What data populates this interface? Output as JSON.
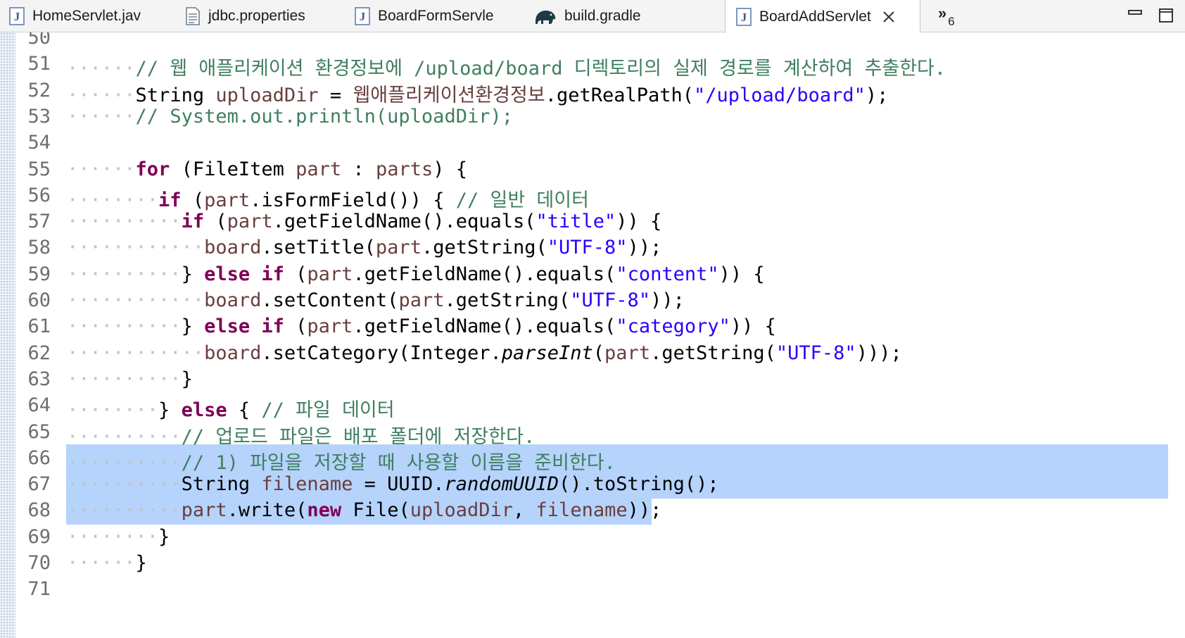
{
  "tabs": [
    {
      "label": "HomeServlet.jav",
      "icon": "java-file-icon"
    },
    {
      "label": "jdbc.properties",
      "icon": "properties-file-icon"
    },
    {
      "label": "BoardFormServle",
      "icon": "java-file-icon"
    },
    {
      "label": "build.gradle",
      "icon": "gradle-elephant-icon"
    },
    {
      "label": "BoardAddServlet",
      "icon": "java-file-icon",
      "active": true
    }
  ],
  "overflow": {
    "symbol": "»",
    "count": "6"
  },
  "editor": {
    "selection_lines": [
      66,
      67,
      68
    ],
    "lines": [
      {
        "num": "50",
        "tokens": []
      },
      {
        "num": "51",
        "tokens": [
          [
            "ws",
            "······"
          ],
          [
            "cm",
            "// 웹 애플리케이션 환경정보에 /upload/board 디렉토리의 실제 경로를 계산하여 추출한다."
          ]
        ]
      },
      {
        "num": "52",
        "tokens": [
          [
            "ws",
            "······"
          ],
          [
            "",
            "String "
          ],
          [
            "fd",
            "uploadDir"
          ],
          [
            "",
            " = "
          ],
          [
            "fd",
            "웹애플리케이션환경정보"
          ],
          [
            "",
            ".getRealPath("
          ],
          [
            "st",
            "\"/upload/board\""
          ],
          [
            "",
            ");"
          ]
        ]
      },
      {
        "num": "53",
        "tokens": [
          [
            "ws",
            "······"
          ],
          [
            "cm",
            "// System.out.println(uploadDir);"
          ]
        ]
      },
      {
        "num": "54",
        "tokens": []
      },
      {
        "num": "55",
        "tokens": [
          [
            "ws",
            "······"
          ],
          [
            "kw",
            "for"
          ],
          [
            "",
            " (FileItem "
          ],
          [
            "fd",
            "part"
          ],
          [
            "",
            " : "
          ],
          [
            "fd",
            "parts"
          ],
          [
            "",
            ") {"
          ]
        ]
      },
      {
        "num": "56",
        "tokens": [
          [
            "ws",
            "········"
          ],
          [
            "kw",
            "if"
          ],
          [
            "",
            " ("
          ],
          [
            "fd",
            "part"
          ],
          [
            "",
            ".isFormField()) { "
          ],
          [
            "cm",
            "// 일반 데이터"
          ]
        ]
      },
      {
        "num": "57",
        "tokens": [
          [
            "ws",
            "··········"
          ],
          [
            "kw",
            "if"
          ],
          [
            "",
            " ("
          ],
          [
            "fd",
            "part"
          ],
          [
            "",
            ".getFieldName().equals("
          ],
          [
            "st",
            "\"title\""
          ],
          [
            "",
            ")) {"
          ]
        ]
      },
      {
        "num": "58",
        "tokens": [
          [
            "ws",
            "············"
          ],
          [
            "fd",
            "board"
          ],
          [
            "",
            ".setTitle("
          ],
          [
            "fd",
            "part"
          ],
          [
            "",
            ".getString("
          ],
          [
            "st",
            "\"UTF-8\""
          ],
          [
            "",
            "));"
          ]
        ]
      },
      {
        "num": "59",
        "tokens": [
          [
            "ws",
            "··········"
          ],
          [
            "",
            "} "
          ],
          [
            "kw",
            "else"
          ],
          [
            "",
            " "
          ],
          [
            "kw",
            "if"
          ],
          [
            "",
            " ("
          ],
          [
            "fd",
            "part"
          ],
          [
            "",
            ".getFieldName().equals("
          ],
          [
            "st",
            "\"content\""
          ],
          [
            "",
            ")) {"
          ]
        ]
      },
      {
        "num": "60",
        "tokens": [
          [
            "ws",
            "············"
          ],
          [
            "fd",
            "board"
          ],
          [
            "",
            ".setContent("
          ],
          [
            "fd",
            "part"
          ],
          [
            "",
            ".getString("
          ],
          [
            "st",
            "\"UTF-8\""
          ],
          [
            "",
            "));"
          ]
        ]
      },
      {
        "num": "61",
        "tokens": [
          [
            "ws",
            "··········"
          ],
          [
            "",
            "} "
          ],
          [
            "kw",
            "else"
          ],
          [
            "",
            " "
          ],
          [
            "kw",
            "if"
          ],
          [
            "",
            " ("
          ],
          [
            "fd",
            "part"
          ],
          [
            "",
            ".getFieldName().equals("
          ],
          [
            "st",
            "\"category\""
          ],
          [
            "",
            ")) {"
          ]
        ]
      },
      {
        "num": "62",
        "tokens": [
          [
            "ws",
            "············"
          ],
          [
            "fd",
            "board"
          ],
          [
            "",
            ".setCategory(Integer."
          ],
          [
            "it",
            "parseInt"
          ],
          [
            "",
            "("
          ],
          [
            "fd",
            "part"
          ],
          [
            "",
            ".getString("
          ],
          [
            "st",
            "\"UTF-8\""
          ],
          [
            "",
            ")));"
          ]
        ]
      },
      {
        "num": "63",
        "tokens": [
          [
            "ws",
            "··········"
          ],
          [
            "",
            "}"
          ]
        ]
      },
      {
        "num": "64",
        "tokens": [
          [
            "ws",
            "········"
          ],
          [
            "",
            "} "
          ],
          [
            "kw",
            "else"
          ],
          [
            "",
            " { "
          ],
          [
            "cm",
            "// 파일 데이터"
          ]
        ]
      },
      {
        "num": "65",
        "tokens": [
          [
            "ws",
            "··········"
          ],
          [
            "cm",
            "// 업로드 파일은 배포 폴더에 저장한다."
          ]
        ]
      },
      {
        "num": "66",
        "tokens": [
          [
            "ws",
            "··········"
          ],
          [
            "cm",
            "// 1) 파일을 저장할 때 사용할 이름을 준비한다."
          ]
        ]
      },
      {
        "num": "67",
        "tokens": [
          [
            "ws",
            "··········"
          ],
          [
            "",
            "String "
          ],
          [
            "fd",
            "filename"
          ],
          [
            "",
            " = UUID."
          ],
          [
            "it",
            "randomUUID"
          ],
          [
            "",
            "().toString();"
          ]
        ]
      },
      {
        "num": "68",
        "tokens": [
          [
            "ws",
            "··········"
          ],
          [
            "fd",
            "part"
          ],
          [
            "",
            ".write("
          ],
          [
            "kw",
            "new"
          ],
          [
            "",
            " File("
          ],
          [
            "fd",
            "uploadDir"
          ],
          [
            "",
            ", "
          ],
          [
            "fd",
            "filename"
          ],
          [
            "",
            "));"
          ]
        ]
      },
      {
        "num": "69",
        "tokens": [
          [
            "ws",
            "········"
          ],
          [
            "",
            "}"
          ]
        ]
      },
      {
        "num": "70",
        "tokens": [
          [
            "ws",
            "······"
          ],
          [
            "",
            "}"
          ]
        ]
      },
      {
        "num": "71",
        "tokens": []
      }
    ]
  }
}
